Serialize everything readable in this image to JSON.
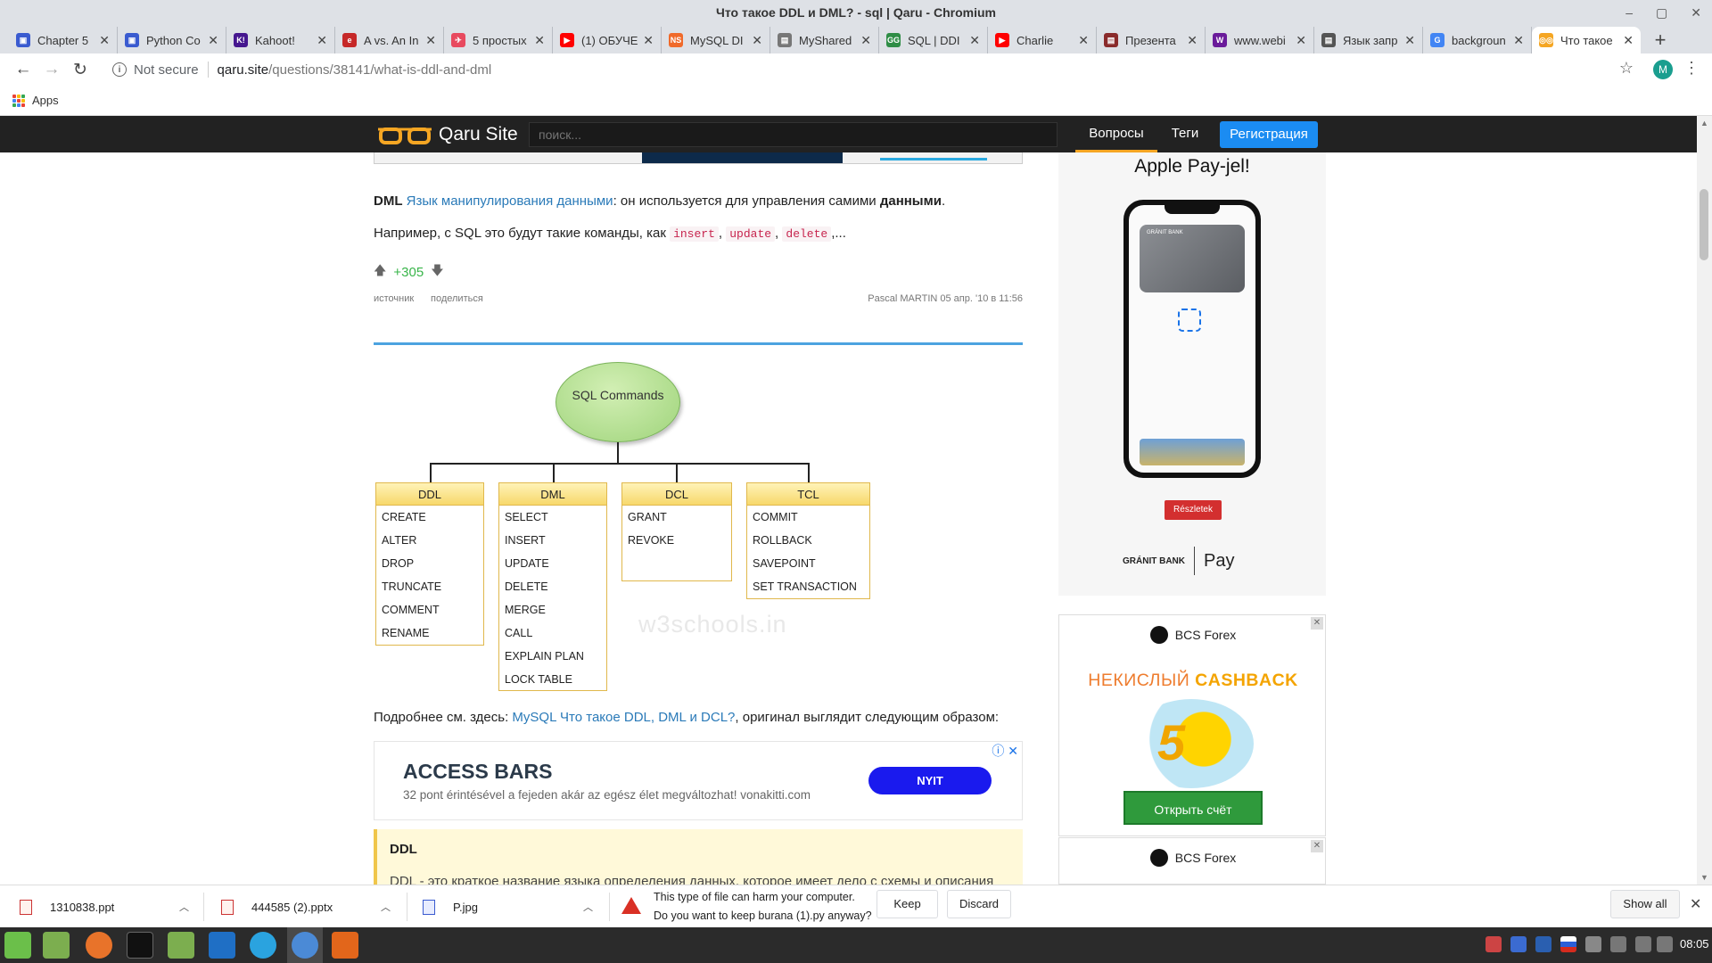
{
  "window": {
    "title": "Что такое DDL и DML? - sql | Qaru - Chromium"
  },
  "tabs": [
    {
      "title": "Chapter 5",
      "color": "#3a5bd0",
      "glyph": "▣"
    },
    {
      "title": "Python Co",
      "color": "#3a5bd0",
      "glyph": "▣"
    },
    {
      "title": "Kahoot!",
      "color": "#46178f",
      "glyph": "K!"
    },
    {
      "title": "A vs. An In",
      "color": "#c62828",
      "glyph": "e"
    },
    {
      "title": "5 простых",
      "color": "#e84a5f",
      "glyph": "✈"
    },
    {
      "title": "(1) ОБУЧЕ",
      "color": "#ff0000",
      "glyph": "▶"
    },
    {
      "title": "MySQL DI",
      "color": "#f06a2a",
      "glyph": "NS"
    },
    {
      "title": "MyShared",
      "color": "#777777",
      "glyph": "▤"
    },
    {
      "title": "SQL | DDI",
      "color": "#2f8d46",
      "glyph": "GG"
    },
    {
      "title": "Charlie",
      "color": "#ff0000",
      "glyph": "▶"
    },
    {
      "title": "Презента",
      "color": "#8a2b2b",
      "glyph": "▤"
    },
    {
      "title": "www.webi",
      "color": "#6a1b9a",
      "glyph": "W"
    },
    {
      "title": "Язык запр",
      "color": "#555555",
      "glyph": "▤"
    },
    {
      "title": "backgroun",
      "color": "#4285f4",
      "glyph": "G"
    },
    {
      "title": "Что такое",
      "color": "#f5a623",
      "glyph": "◎◎"
    }
  ],
  "toolbar": {
    "not_secure": "Not secure",
    "host": "qaru.site",
    "path": "/questions/38141/what-is-ddl-and-dml",
    "avatar": "M"
  },
  "bookmarks": {
    "apps": "Apps"
  },
  "site": {
    "logo": "Qaru Site",
    "search_placeholder": "поиск...",
    "nav_questions": "Вопросы",
    "nav_tags": "Теги",
    "register": "Регистрация"
  },
  "answer": {
    "dml_abbr": "DML",
    "dml_link": "Язык манипулирования данными",
    "dml_rest": ": он используется для управления самими ",
    "dml_bold": "данными",
    "dml_end": ".",
    "example_pre": "Например, с SQL это будут такие команды, как ",
    "codes": [
      "insert",
      "update",
      "delete"
    ],
    "example_end": ",...",
    "votes": "+305",
    "source": "источник",
    "share": "поделиться",
    "author": "Pascal MARTIN 05 апр. '10 в 11:56"
  },
  "diagram": {
    "root": "SQL Commands",
    "groups": [
      {
        "name": "DDL",
        "items": [
          "CREATE",
          "ALTER",
          "DROP",
          "TRUNCATE",
          "COMMENT",
          "RENAME"
        ]
      },
      {
        "name": "DML",
        "items": [
          "SELECT",
          "INSERT",
          "UPDATE",
          "DELETE",
          "MERGE",
          "CALL",
          "EXPLAIN PLAN",
          "LOCK TABLE"
        ]
      },
      {
        "name": "DCL",
        "items": [
          "GRANT",
          "REVOKE"
        ]
      },
      {
        "name": "TCL",
        "items": [
          "COMMIT",
          "ROLLBACK",
          "SAVEPOINT",
          "SET TRANSACTION"
        ]
      }
    ],
    "watermark": "w3schools.in"
  },
  "more": {
    "pre": "Подробнее см. здесь: ",
    "link": "MySQL Что такое DDL, DML и DCL?",
    "post": ", оригинал выглядит следующим образом:"
  },
  "inline_ad": {
    "title": "ACCESS BARS",
    "text": "32 pont érintésével a fejeden akár az egész élet megváltozhat! vonakitti.com",
    "button": "NYIT"
  },
  "ddl_block": {
    "title": "DDL",
    "text": "DDL - это краткое название языка определения данных, которое имеет дело с схемы и описания"
  },
  "side_ad1": {
    "headline": "Apple Pay-jel!",
    "button": "Részletek",
    "bank": "GRÁNIT BANK",
    "pay": "Pay"
  },
  "side_ad2": {
    "brand": "BCS Forex",
    "cb1": "НЕКИСЛЫЙ ",
    "cb2": "CASHBACK",
    "big": "5",
    "button": "Открыть счёт"
  },
  "side_ad3": {
    "brand": "BCS Forex"
  },
  "downloads": {
    "items": [
      "1310838.ppt",
      "444585 (2).pptx",
      "P.jpg"
    ],
    "warn1": "This type of file can harm your computer.",
    "warn2": "Do you want to keep burana (1).py anyway?",
    "keep": "Keep",
    "discard": "Discard",
    "show_all": "Show all"
  },
  "taskbar": {
    "clock": "08:05"
  }
}
